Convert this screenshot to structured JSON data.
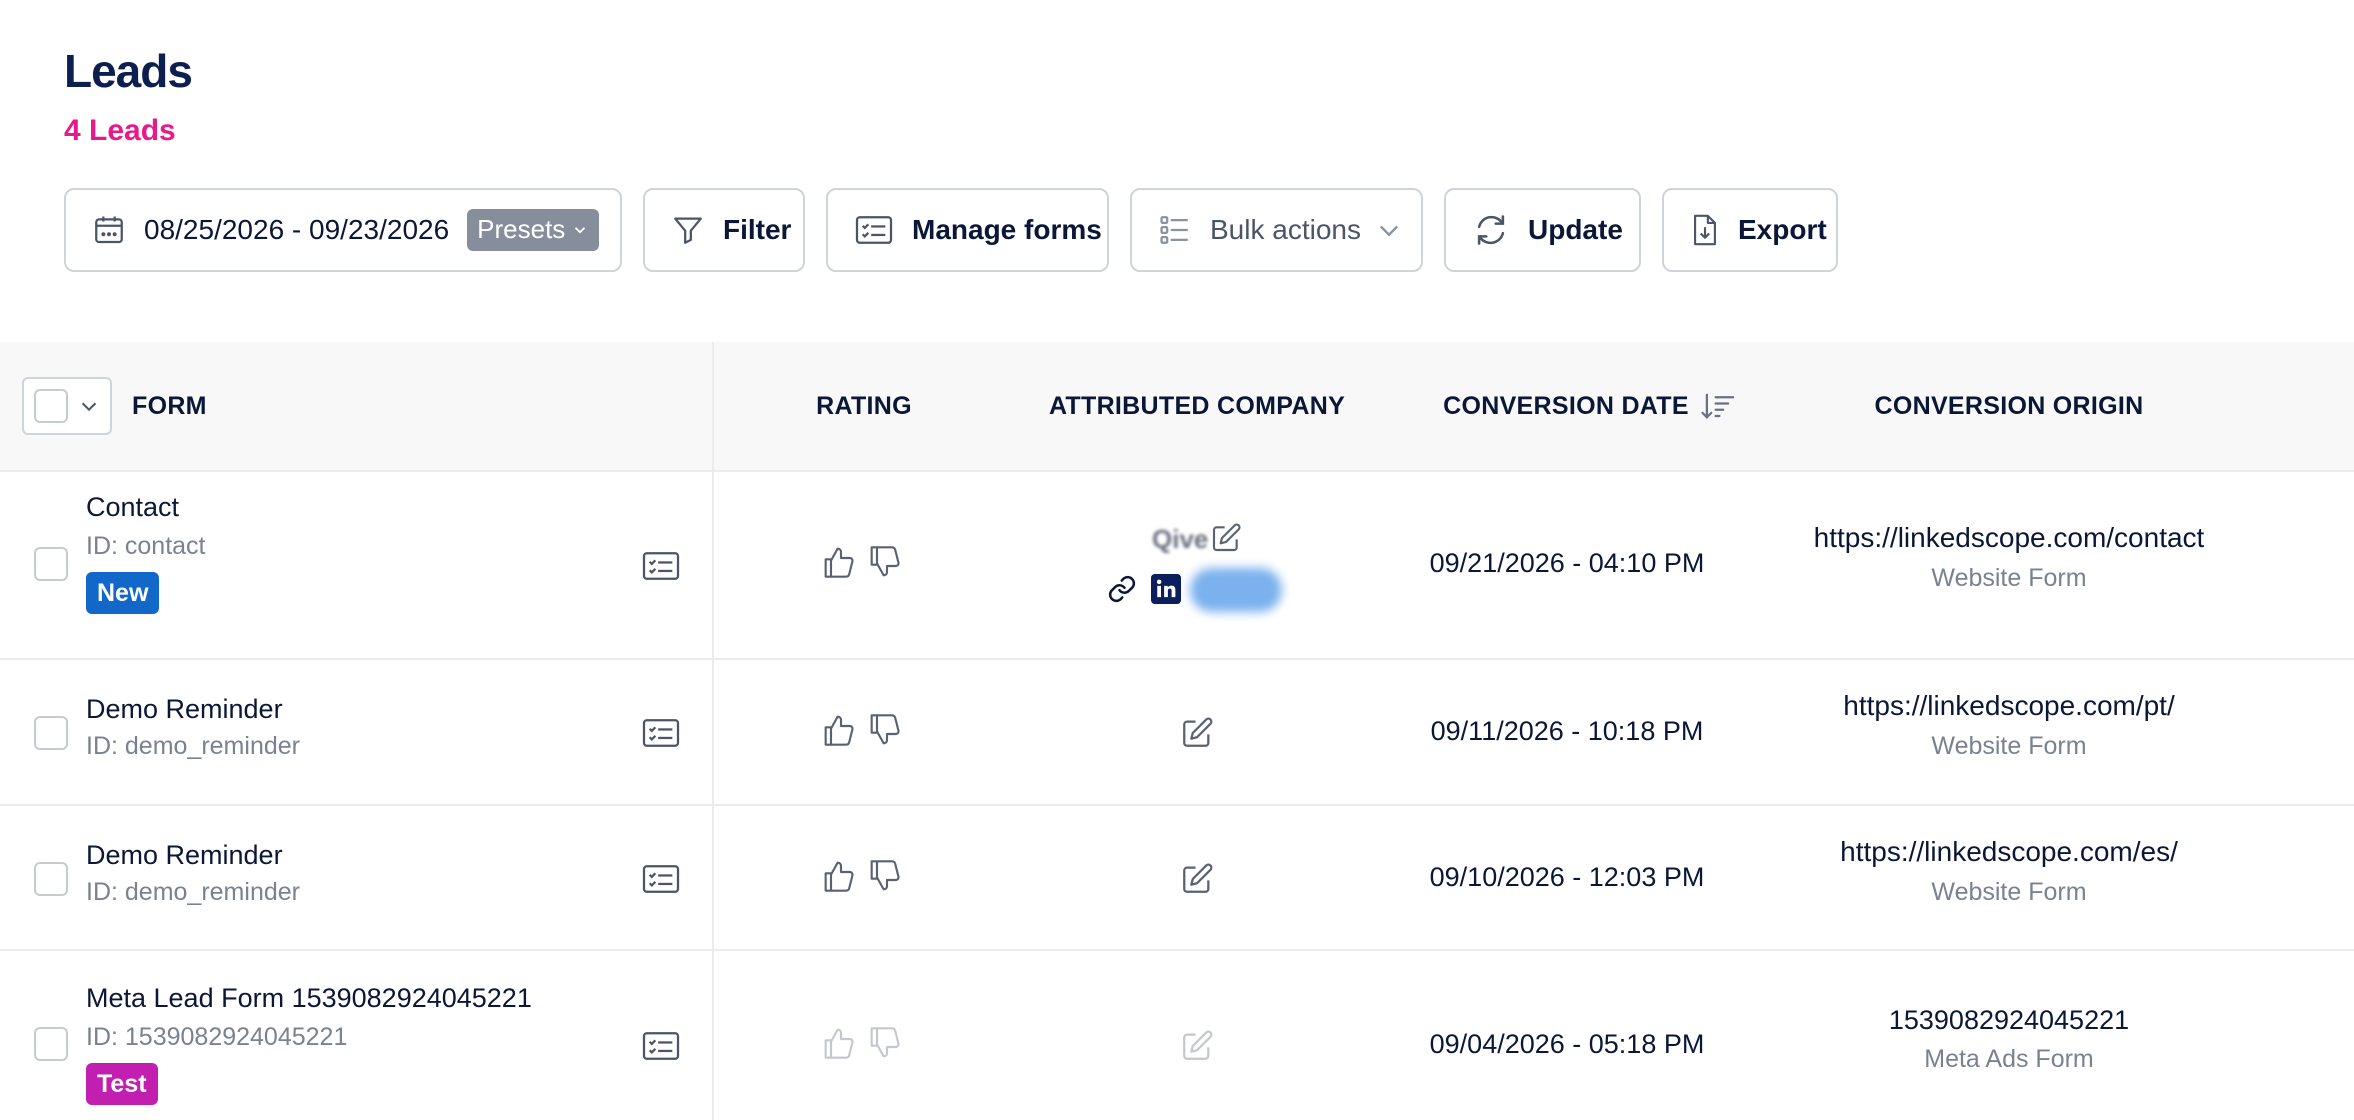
{
  "header": {
    "title": "Leads",
    "count": "4 Leads"
  },
  "toolbar": {
    "date_range": "08/25/2026 - 09/23/2026",
    "presets_label": "Presets",
    "filter_label": "Filter",
    "manage_forms_label": "Manage forms",
    "bulk_actions_label": "Bulk actions",
    "update_label": "Update",
    "export_label": "Export"
  },
  "table": {
    "columns": {
      "form": "FORM",
      "rating": "RATING",
      "company": "ATTRIBUTED COMPANY",
      "date": "CONVERSION DATE",
      "origin": "CONVERSION ORIGIN"
    },
    "rows": [
      {
        "form_name": "Contact",
        "form_id": "ID: contact",
        "badge": "New",
        "company_name": "Qive",
        "date": "09/21/2026 - 04:10 PM",
        "origin_url": "https://linkedscope.com/contact",
        "origin_type": "Website Form"
      },
      {
        "form_name": "Demo Reminder",
        "form_id": "ID: demo_reminder",
        "date": "09/11/2026 - 10:18 PM",
        "origin_url": "https://linkedscope.com/pt/",
        "origin_type": "Website Form"
      },
      {
        "form_name": "Demo Reminder",
        "form_id": "ID: demo_reminder",
        "date": "09/10/2026 - 12:03 PM",
        "origin_url": "https://linkedscope.com/es/",
        "origin_type": "Website Form"
      },
      {
        "form_name": "Meta Lead Form 1539082924045221",
        "form_id": "ID: 1539082924045221",
        "badge": "Test",
        "date": "09/04/2026 - 05:18 PM",
        "origin_url": "1539082924045221",
        "origin_type": "Meta Ads Form"
      }
    ]
  },
  "colors": {
    "title": "#0d1f4f",
    "count": "#e8198b",
    "badge_new": "#1268c8",
    "badge_test": "#c21fb0",
    "linkedin": "#0a1f5c"
  },
  "icons": [
    "calendar-icon",
    "filter-icon",
    "form-list-icon",
    "checklist-icon",
    "chevron-down-icon",
    "refresh-icon",
    "file-download-icon",
    "sort-desc-icon",
    "thumbs-up-icon",
    "thumbs-down-icon",
    "edit-icon",
    "link-icon",
    "linkedin-icon"
  ]
}
